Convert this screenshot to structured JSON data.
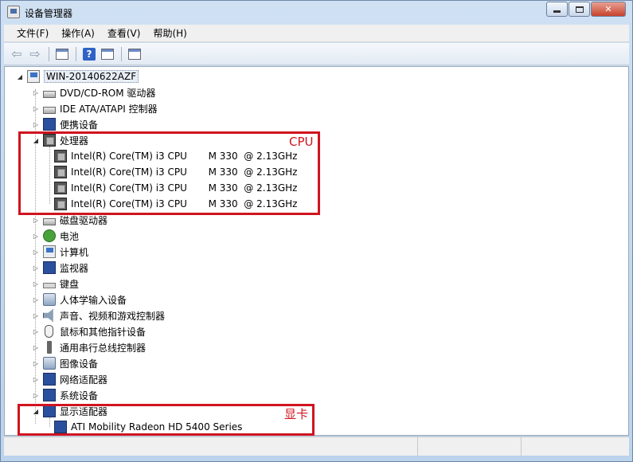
{
  "window": {
    "title": "设备管理器"
  },
  "menu": [
    "文件(F)",
    "操作(A)",
    "查看(V)",
    "帮助(H)"
  ],
  "toolbar": {
    "icons": [
      "back-arrow-icon",
      "forward-arrow-icon",
      "properties-icon",
      "help-icon",
      "show-hidden-icon",
      "scan-hardware-icon"
    ],
    "help_glyph": "?"
  },
  "tree": {
    "root": "WIN-20140622AZF",
    "categories": {
      "dvd": "DVD/CD-ROM 驱动器",
      "ide": "IDE ATA/ATAPI 控制器",
      "portable": "便携设备",
      "processor": "处理器",
      "disk": "磁盘驱动器",
      "battery": "电池",
      "computer": "计算机",
      "monitor": "监视器",
      "keyboard": "键盘",
      "hid": "人体学输入设备",
      "sound": "声音、视频和游戏控制器",
      "mouse": "鼠标和其他指针设备",
      "usb": "通用串行总线控制器",
      "imaging": "图像设备",
      "network": "网络适配器",
      "system": "系统设备",
      "display": "显示适配器"
    },
    "processors": [
      "Intel(R) Core(TM) i3 CPU       M 330  @ 2.13GHz",
      "Intel(R) Core(TM) i3 CPU       M 330  @ 2.13GHz",
      "Intel(R) Core(TM) i3 CPU       M 330  @ 2.13GHz",
      "Intel(R) Core(TM) i3 CPU       M 330  @ 2.13GHz"
    ],
    "display_adapters": [
      "ATI Mobility Radeon HD 5400 Series"
    ]
  },
  "annotations": {
    "cpu_label": "CPU",
    "gpu_label": "显卡",
    "color": "#d0141f"
  }
}
